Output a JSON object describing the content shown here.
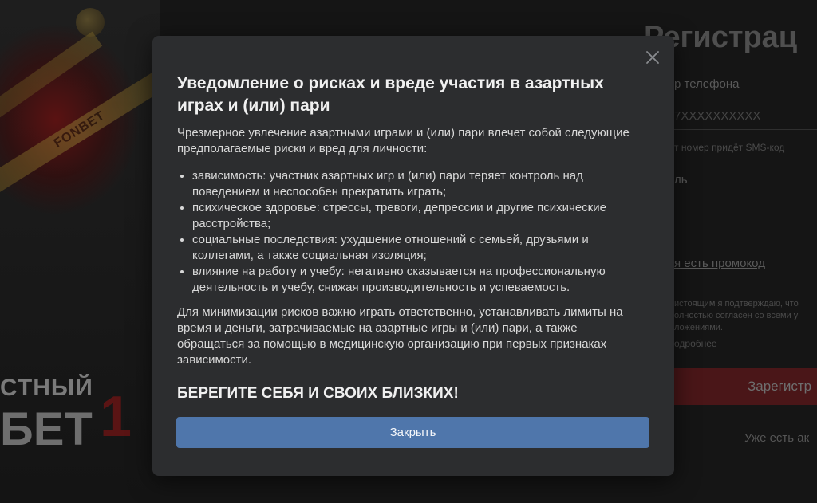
{
  "background": {
    "brand_ribbon": "FONBET",
    "promo_line1": "СТНЫЙ",
    "promo_line2": "БЕТ",
    "promo_number": "1",
    "registration": {
      "title": "Регистрац",
      "phone_label": "р телефона",
      "phone_placeholder": "7XXXXXXXXXX",
      "sms_hint": "т номер придёт SMS-код",
      "password_label": "ль",
      "promo_link": "я есть промокод",
      "consent_line1": "истоящим я подтверждаю, что",
      "consent_line2": "олностью согласен со всеми у",
      "consent_line3": "ложениями.",
      "more_link": "одробнее",
      "register_button": "Зарегистр",
      "login_link": "Уже есть ак"
    }
  },
  "modal": {
    "title": "Уведомление о рисках и вреде участия в азартных играх и (или) пари",
    "intro": "Чрезмерное увлечение азартными играми и (или) пари влечет собой следующие предполагаемые риски и вред для личности:",
    "risks": [
      "зависимость: участник азартных игр и (или) пари теряет контроль над поведением и неспособен прекратить играть;",
      "психическое здоровье: стрессы, тревоги, депрессии и другие психические расстройства;",
      "социальные последствия: ухудшение отношений с семьей, друзьями и коллегами, а также социальная изоляция;",
      "влияние на работу и учебу: негативно сказывается на профессиональную деятельность и учебу, снижая производительность и успеваемость."
    ],
    "outro": "Для минимизации рисков важно играть ответственно, устанавливать лимиты на время и деньги, затрачиваемые на азартные игры и (или) пари, а также обращаться за помощью в медицинскую организацию при первых признаках зависимости.",
    "care_heading": "БЕРЕГИТЕ СЕБЯ И СВОИХ БЛИЗКИХ!",
    "close_button": "Закрыть",
    "close_icon": "close-icon"
  },
  "colors": {
    "modal_bg": "#2c2d2f",
    "button_bg": "#4f76ab",
    "page_bg": "#151515"
  }
}
